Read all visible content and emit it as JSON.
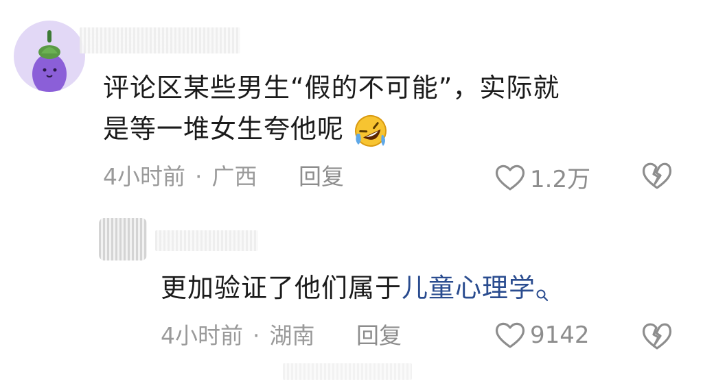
{
  "comment": {
    "text_line1": "评论区某些男生“假的不可能”，实际就",
    "text_line2": "是等一堆女生夸他呢",
    "emoji_icon": "rolling-laughing-emoji",
    "time": "4小时前",
    "separator": "·",
    "location": "广西",
    "reply_label": "回复",
    "like_count": "1.2万"
  },
  "reply": {
    "text_prefix": "更加验证了他们属于",
    "link_text": "儿童心理学",
    "time": "4小时前",
    "separator": "·",
    "location": "湖南",
    "reply_label": "回复",
    "like_count": "9142"
  },
  "colors": {
    "link": "#2a4c8f",
    "meta": "#9a9a9a",
    "avatar_bg": "#e2d8f6",
    "eggplant": "#8b5fd8"
  }
}
